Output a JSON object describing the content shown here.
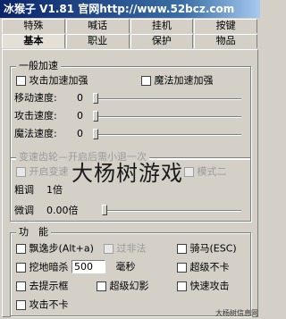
{
  "window": {
    "title": "冰猴子 V1.81 官网http://www.52bcz.com"
  },
  "tabs_row1": [
    "特殊",
    "喊话",
    "挂机",
    "按键"
  ],
  "tabs_row2": [
    "基本",
    "职业",
    "保护",
    "物品"
  ],
  "general_speed": {
    "title": "一般加速",
    "attack_boost": "攻击加速加强",
    "magic_boost": "魔法加速加强",
    "sliders": [
      {
        "label": "移动速度:",
        "value": "0"
      },
      {
        "label": "攻击速度:",
        "value": "0"
      },
      {
        "label": "魔法速度:",
        "value": "0"
      }
    ]
  },
  "gear_speed": {
    "title": "变速齿轮—开启后需小退一次",
    "enable": "开启变速",
    "mode2": "模式二",
    "coarse_label": "粗调",
    "coarse_value": "1倍",
    "fine_label": "微调",
    "fine_value": "0.00倍"
  },
  "functions": {
    "title": "功　能",
    "items": [
      {
        "label": "飘逸步(Alt+a)"
      },
      {
        "label": "过非法",
        "disabled": true
      },
      {
        "label": "骑马(ESC)"
      },
      {
        "label": "挖地暗杀"
      },
      {
        "label": "超级不卡"
      },
      {
        "label": "去提示框"
      },
      {
        "label": "超级幻影"
      },
      {
        "label": "快速攻击"
      },
      {
        "label": "攻击不卡"
      }
    ],
    "ms_value": "500",
    "ms_unit": "毫秒"
  },
  "watermark": "大杨树游戏",
  "corner_mark": "大杨树信息网"
}
